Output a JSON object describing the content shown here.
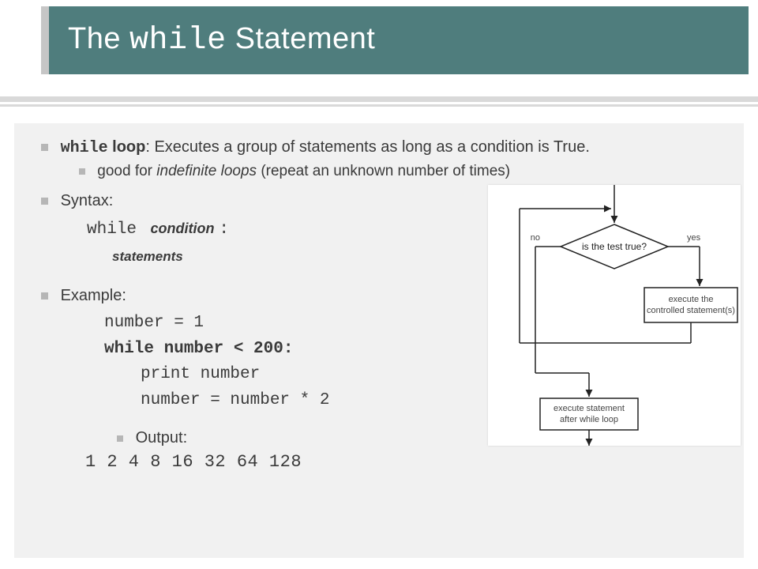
{
  "title": {
    "pre": "The ",
    "code": "while",
    "post": " Statement"
  },
  "bullets": {
    "def_code": "while",
    "def_label": " loop",
    "def_rest": ": Executes a group of statements as long as a condition is True.",
    "sub_good_pre": "good for ",
    "sub_good_em": "indefinite loops",
    "sub_good_post": " (repeat an unknown number of times)",
    "syntax_label": "Syntax:",
    "syntax_while": "while",
    "syntax_cond": "condition",
    "syntax_colon": ":",
    "syntax_stmts": "statements",
    "example_label": "Example:",
    "ex_line1": "number = 1",
    "ex_line2": "while number < 200:",
    "ex_line3": "print number",
    "ex_line4": "number = number * 2",
    "output_label": "Output:",
    "output_values": "1 2 4 8 16 32 64 128"
  },
  "flowchart": {
    "no": "no",
    "yes": "yes",
    "test": "is the test true?",
    "exec1a": "execute the",
    "exec1b": "controlled statement(s)",
    "exec2a": "execute statement",
    "exec2b": "after while loop"
  }
}
